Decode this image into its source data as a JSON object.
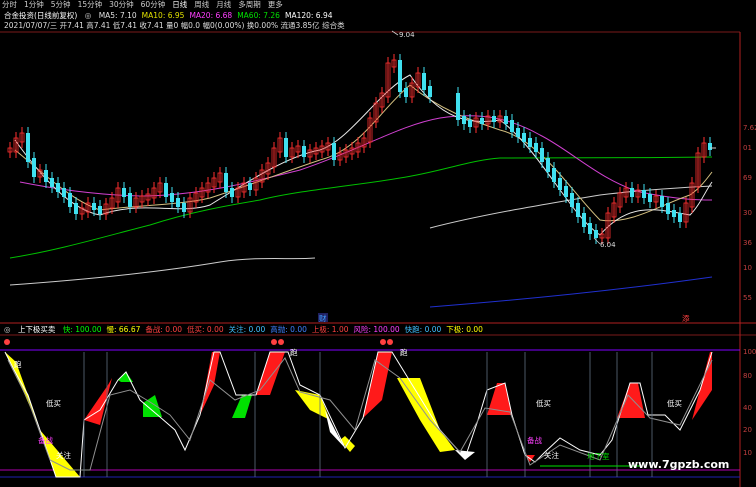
{
  "tabs": [
    "分时",
    "1分钟",
    "5分钟",
    "15分钟",
    "30分钟",
    "60分钟",
    "日线",
    "周线",
    "月线",
    "多周期",
    "更多"
  ],
  "active_tab": "日线",
  "main_title": "合金投资(日线前复权)",
  "ma_legend": [
    {
      "label": "MA5: 7.10",
      "color": "#e0e0e0"
    },
    {
      "label": "MA10: 6.95",
      "color": "#e0e000"
    },
    {
      "label": "MA20: 6.68",
      "color": "#ff40ff"
    },
    {
      "label": "MA60: 7.26",
      "color": "#00e000"
    },
    {
      "label": "MA120: 6.94",
      "color": "#ffffff"
    }
  ],
  "quote_line": "2021/07/07/三 开7.41 高7.41 低7.41 收7.41 量0 幅0.0 幅0(0.00%) 换0.00% 流通3.85亿 综合类",
  "price_high": "9.04",
  "price_low": "6.04",
  "right_axis_main": [
    "7.62",
    "01",
    "69",
    "30",
    "36",
    "10",
    "55"
  ],
  "marker_cai": "财",
  "marker_tan": "添",
  "indicator_title": "上下极买卖",
  "indicator_values": [
    {
      "label": "快: 100.00",
      "color": "#00ff00"
    },
    {
      "label": "慢: 66.67",
      "color": "#ffff00"
    },
    {
      "label": "备战: 0.00",
      "color": "#ff4040"
    },
    {
      "label": "低买: 0.00",
      "color": "#ff4040"
    },
    {
      "label": "关注: 0.00",
      "color": "#40c0ff"
    },
    {
      "label": "高抛: 0.00",
      "color": "#4080ff"
    },
    {
      "label": "上极: 1.00",
      "color": "#ff4040"
    },
    {
      "label": "风险: 100.00",
      "color": "#ff40ff"
    },
    {
      "label": "快跑: 0.00",
      "color": "#40c0ff"
    },
    {
      "label": "下极: 0.00",
      "color": "#ffff00"
    }
  ],
  "signal_labels": {
    "run": "跑",
    "buy_low": "低买",
    "prepare": "备战",
    "watch": "关注",
    "foot": "地下室"
  },
  "right_axis_ind": [
    "100",
    "80",
    "40",
    "20",
    "10"
  ],
  "watermark": "www.7gpzb.com"
}
